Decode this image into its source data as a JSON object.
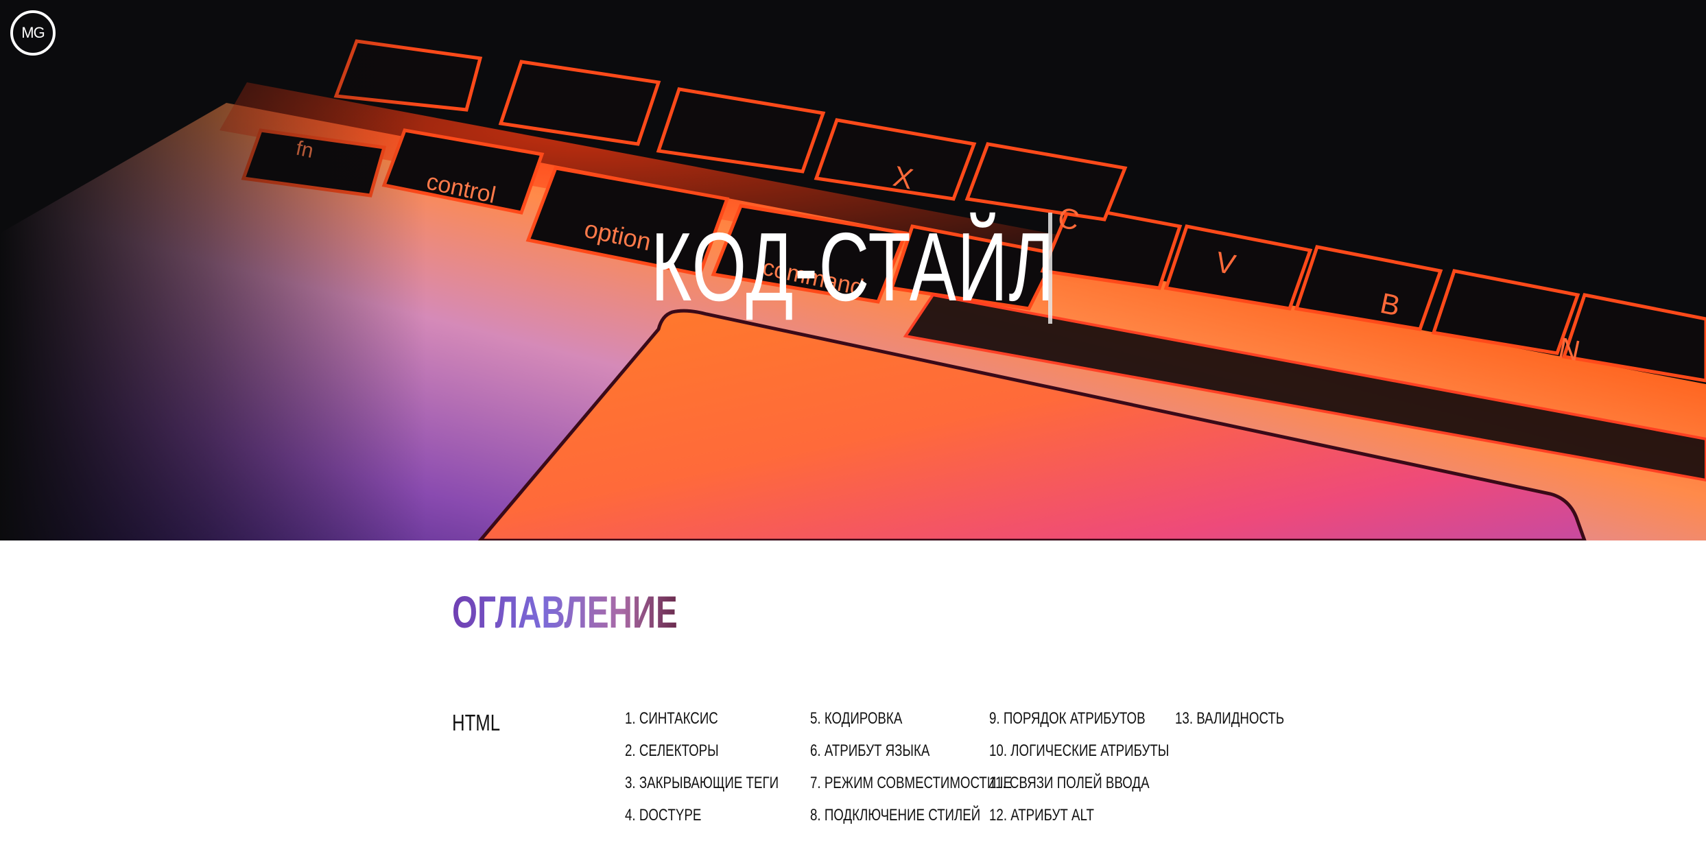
{
  "header": {
    "logo_text": "MG",
    "title": "КОД-СТАЙЛ"
  },
  "hero_image": {
    "keycaps": [
      "fn",
      "control",
      "option",
      "command",
      "C",
      "V",
      "B",
      "N",
      "X"
    ],
    "colors": {
      "background": "#0b0b0d",
      "orange": "#ff6a1a",
      "red": "#ff2a1c",
      "magenta": "#e8226a",
      "pink": "#d98ab8",
      "purple": "#5a2a8c"
    }
  },
  "contents": {
    "heading": "ОГЛАВЛЕНИЕ",
    "heading_gradient": [
      "#6f3fb2",
      "#7b6ad8",
      "#a96aa6",
      "#6a2b4d"
    ],
    "sections": [
      {
        "label": "HTML",
        "columns": [
          [
            "1. СИНТАКСИС",
            "2. СЕЛЕКТОРЫ",
            "3. ЗАКРЫВАЮЩИЕ ТЕГИ",
            "4. DOCTYPE"
          ],
          [
            "5. КОДИРОВКА",
            "6. АТРИБУТ ЯЗЫКА",
            "7. РЕЖИМ СОВМЕСТИМОСТИ IE",
            "8. ПОДКЛЮЧЕНИЕ СТИЛЕЙ"
          ],
          [
            "9. ПОРЯДОК АТРИБУТОВ",
            "10. ЛОГИЧЕСКИЕ АТРИБУТЫ",
            "11. СВЯЗИ ПОЛЕЙ ВВОДА",
            "12. АТРИБУТ ALT"
          ],
          [
            "13. ВАЛИДНОСТЬ"
          ]
        ]
      }
    ]
  }
}
